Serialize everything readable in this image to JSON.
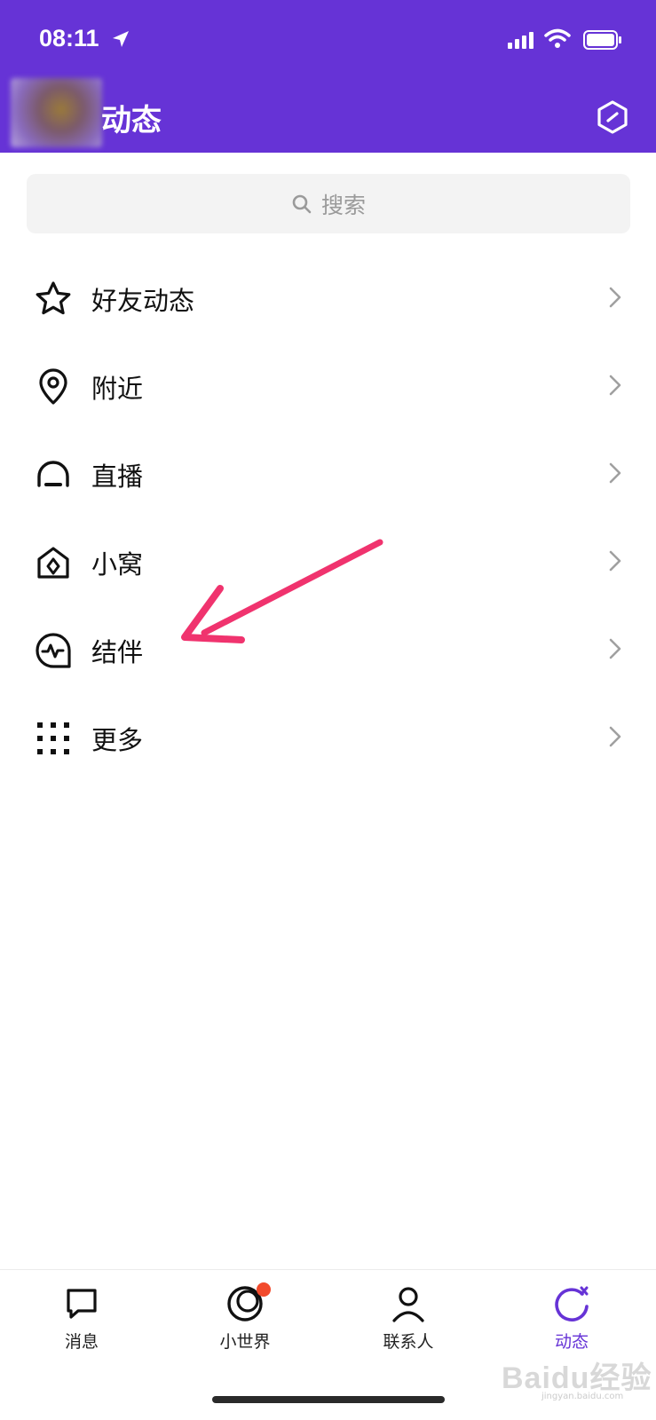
{
  "status_bar": {
    "time": "08:11"
  },
  "header": {
    "title": "动态"
  },
  "search": {
    "placeholder": "搜索"
  },
  "menu": {
    "items": [
      {
        "label": "好友动态",
        "icon": "star-icon"
      },
      {
        "label": "附近",
        "icon": "location-pin-icon"
      },
      {
        "label": "直播",
        "icon": "live-icon"
      },
      {
        "label": "小窝",
        "icon": "nest-house-icon"
      },
      {
        "label": "结伴",
        "icon": "companion-pulse-icon"
      },
      {
        "label": "更多",
        "icon": "grid-dots-icon"
      }
    ]
  },
  "tabbar": {
    "tabs": [
      {
        "label": "消息",
        "icon": "message-icon",
        "active": false
      },
      {
        "label": "小世界",
        "icon": "world-icon",
        "active": false,
        "badge": true
      },
      {
        "label": "联系人",
        "icon": "contacts-icon",
        "active": false
      },
      {
        "label": "动态",
        "icon": "moments-icon",
        "active": true
      }
    ]
  },
  "watermark": {
    "text": "Baidu经验",
    "sub": "jingyan.baidu.com"
  },
  "colors": {
    "accent": "#6633d6",
    "badge": "#f24a2c",
    "annotation": "#f0336e"
  }
}
